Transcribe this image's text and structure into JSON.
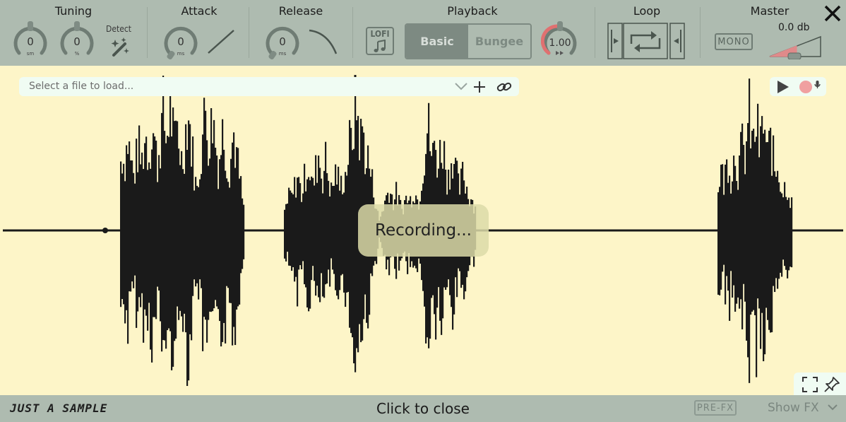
{
  "topbar": {
    "sections": {
      "tuning": "Tuning",
      "attack": "Attack",
      "release": "Release",
      "playback": "Playback",
      "loop": "Loop",
      "master": "Master"
    },
    "tuning": {
      "semitones": {
        "value": "0",
        "unit": "sm"
      },
      "percent": {
        "value": "0",
        "unit": "%"
      },
      "detect_label": "Detect"
    },
    "attack": {
      "value": "0",
      "unit": "ms"
    },
    "release": {
      "value": "0",
      "unit": "ms"
    },
    "playback": {
      "lofi_label": "LOFI",
      "modes": [
        "Basic",
        "Bungee"
      ],
      "selected_mode": "Basic",
      "speed": {
        "value": "1.00"
      }
    },
    "master": {
      "mono_label": "MONO",
      "gain": "0.0 db"
    }
  },
  "file_bar": {
    "placeholder": "Select a file to load..."
  },
  "overlay": {
    "recording_text": "Recording..."
  },
  "bottombar": {
    "brand": "JUST A SAMPLE",
    "click_to_close": "Click to close",
    "prefx_label": "PRE-FX",
    "showfx_label": "Show FX"
  },
  "colors": {
    "topbar_bg": "#aebbb0",
    "wave_bg": "#fdf5c8",
    "waveform": "#1a1a1a",
    "record_dot": "#f0a0a0",
    "speed_arc": "#e07070"
  }
}
